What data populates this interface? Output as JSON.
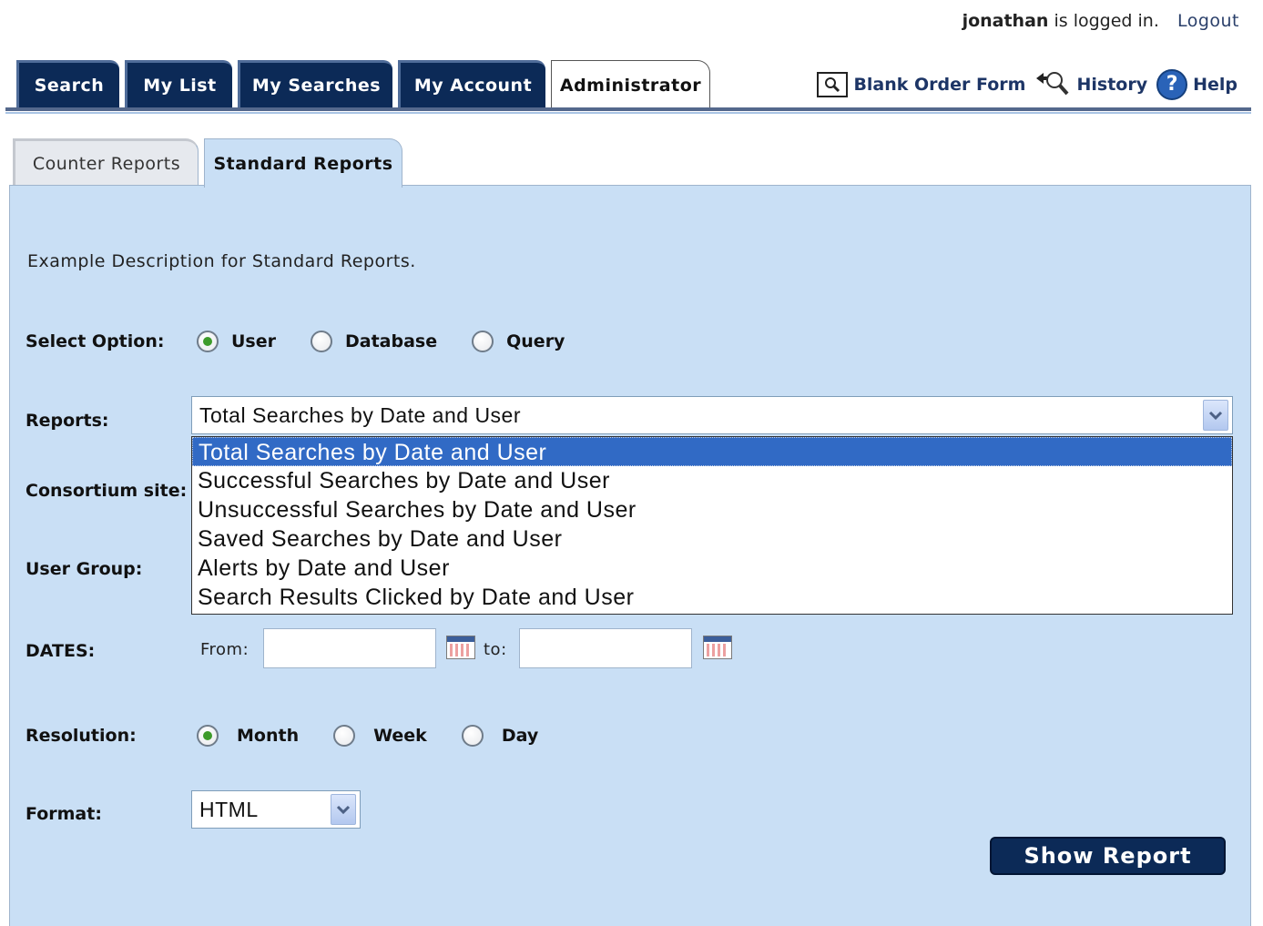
{
  "user": {
    "name": "jonathan",
    "status_text": "is logged in.",
    "logout": "Logout"
  },
  "main_tabs": [
    {
      "label": "Search"
    },
    {
      "label": "My List"
    },
    {
      "label": "My Searches"
    },
    {
      "label": "My Account"
    },
    {
      "label": "Administrator",
      "active": true
    }
  ],
  "top_links": {
    "blank_order_form": "Blank Order Form",
    "history": "History",
    "help": "Help"
  },
  "sub_tabs": [
    {
      "label": "Counter Reports"
    },
    {
      "label": "Standard Reports",
      "active": true
    }
  ],
  "description": "Example Description for Standard Reports.",
  "form": {
    "select_option_label": "Select Option:",
    "select_options": [
      "User",
      "Database",
      "Query"
    ],
    "selected_option": "User",
    "reports_label": "Reports:",
    "reports_value": "Total Searches by Date and User",
    "report_list": [
      "Total Searches by Date and User",
      "Successful Searches by Date and User",
      "Unsuccessful Searches by Date and User",
      "Saved Searches by Date and User",
      "Alerts by Date and User",
      "Search Results Clicked by Date and User"
    ],
    "consortium_label": "Consortium site:",
    "user_group_label": "User Group:",
    "dates_label": "DATES:",
    "from_label": "From:",
    "to_label": "to:",
    "from_value": "",
    "to_value": "",
    "resolution_label": "Resolution:",
    "resolution_options": [
      "Month",
      "Week",
      "Day"
    ],
    "selected_resolution": "Month",
    "format_label": "Format:",
    "format_value": "HTML",
    "show_report": "Show Report"
  },
  "colors": {
    "nav_bg": "#0c2a57",
    "panel_bg": "#c9dff5",
    "highlight": "#316ac5",
    "radio_dot": "#3d9b2a"
  }
}
